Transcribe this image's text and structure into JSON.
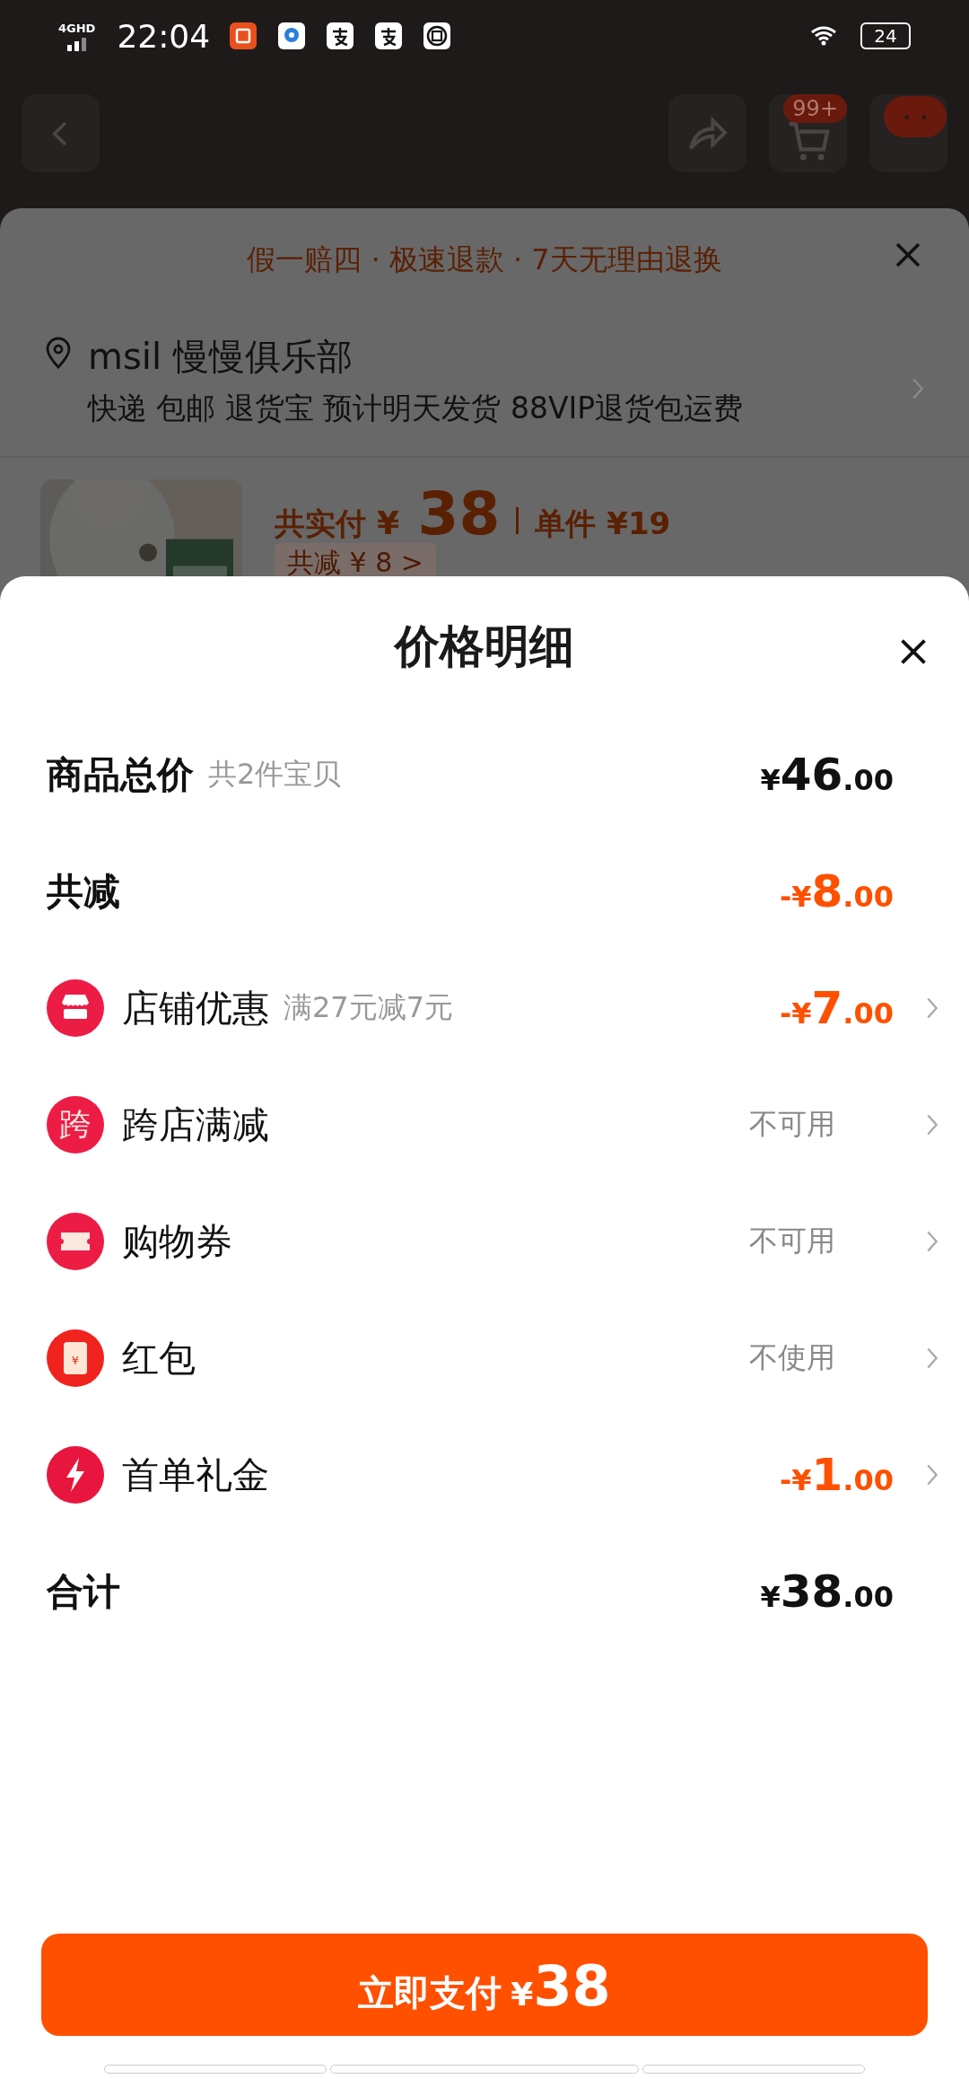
{
  "status_bar": {
    "network": "4GHD",
    "time": "22:04",
    "battery": "24"
  },
  "nav": {
    "cart_badge": "99+"
  },
  "order_sheet": {
    "guarantee": "假一赔四 · 极速退款 · 7天无理由退换",
    "address_name": "msil 慢慢俱乐部",
    "delivery": "快递 包邮 退货宝 预计明天发货 88VIP退货包运费",
    "paid_label": "共实付",
    "paid_amount": "¥ 38",
    "unit_label": "单件",
    "unit_price": "¥19",
    "saving_tag": "共减 ¥ 8 >"
  },
  "price_detail": {
    "title": "价格明细",
    "rows": [
      {
        "kind": "summary",
        "label": "商品总价",
        "note": "共2件宝贝",
        "value": "¥46.00",
        "highlight": false
      },
      {
        "kind": "summary",
        "label": "共减",
        "value": "-¥8.00",
        "highlight": true
      },
      {
        "kind": "discount",
        "label": "店铺优惠",
        "note": "满27元减7元",
        "value": "-¥7.00",
        "highlight": true
      },
      {
        "kind": "discount",
        "label": "跨店满减",
        "icon_text": "跨",
        "value": "不可用",
        "highlight": false
      },
      {
        "kind": "discount",
        "label": "购物券",
        "value": "不可用",
        "highlight": false
      },
      {
        "kind": "discount",
        "label": "红包",
        "icon_text": "¥",
        "value": "不使用",
        "highlight": false
      },
      {
        "kind": "discount",
        "label": "首单礼金",
        "value": "-¥1.00",
        "highlight": true
      },
      {
        "kind": "summary",
        "label": "合计",
        "value": "¥38.00",
        "highlight": false
      }
    ],
    "pay_button": {
      "label": "立即支付",
      "amount": "¥38"
    }
  }
}
